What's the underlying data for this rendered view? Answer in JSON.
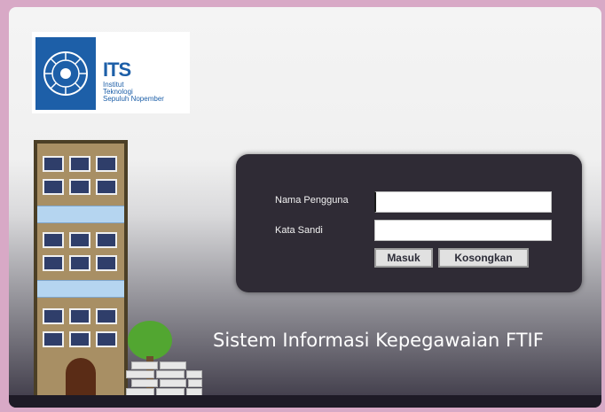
{
  "logo": {
    "wordmark": "ITS",
    "line1": "Institut",
    "line2": "Teknologi",
    "line3": "Sepuluh Nopember"
  },
  "login": {
    "username_label": "Nama Pengguna",
    "password_label": "Kata Sandi",
    "username_value": "",
    "password_value": "",
    "login_button": "Masuk",
    "clear_button": "Kosongkan"
  },
  "app_title": "Sistem Informasi Kepegawaian FTIF",
  "colors": {
    "page_border": "#d8a9c6",
    "panel_bg": "#2f2b35",
    "brand_blue": "#1d5fa8"
  }
}
